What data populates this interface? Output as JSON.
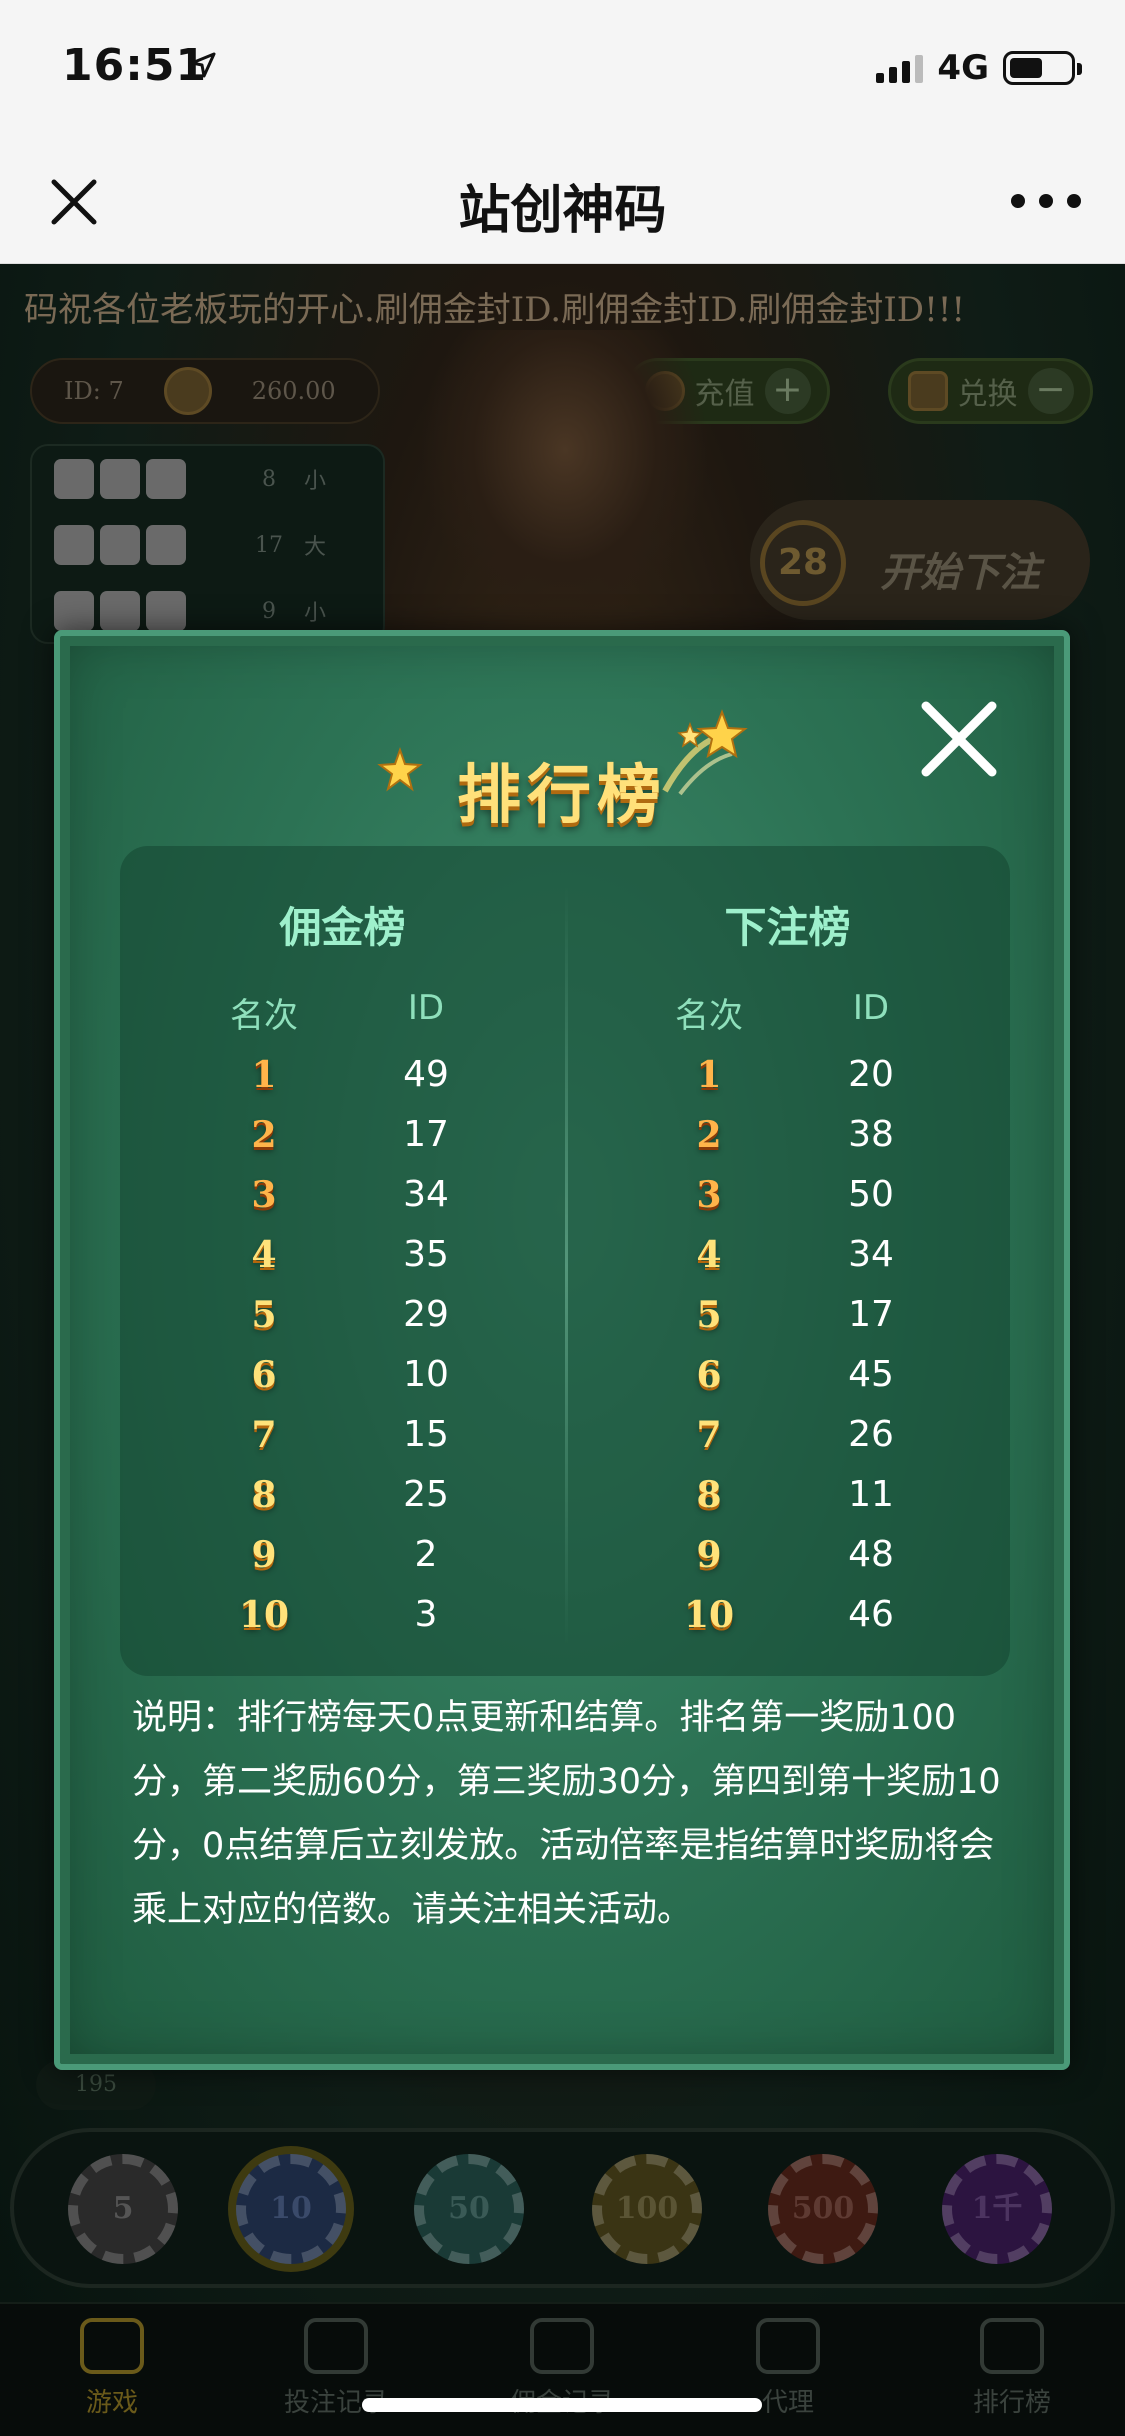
{
  "status_bar": {
    "time": "16:51",
    "network": "4G"
  },
  "nav": {
    "title": "站创神码"
  },
  "game": {
    "marquee": "码祝各位老板玩的开心.刷佣金封ID.刷佣金封ID.刷佣金封ID!!!",
    "user_id": "ID: 7",
    "balance": "260.00",
    "recharge_label": "充值",
    "exchange_label": "兑换",
    "history": [
      {
        "sum": "8",
        "result": "小"
      },
      {
        "sum": "17",
        "result": "大"
      },
      {
        "sum": "9",
        "result": "小"
      }
    ],
    "countdown": "28",
    "start_bet_label": "开始下注",
    "bottom_count": "195",
    "chips": [
      "5",
      "10",
      "50",
      "100",
      "500",
      "1千"
    ],
    "tabs": [
      "游戏",
      "投注记录",
      "佣金记录",
      "代理",
      "排行榜"
    ]
  },
  "leaderboard": {
    "title": "排行榜",
    "commission": {
      "title": "佣金榜",
      "rank_header": "名次",
      "id_header": "ID",
      "rows": [
        {
          "rank": "1",
          "id": "49"
        },
        {
          "rank": "2",
          "id": "17"
        },
        {
          "rank": "3",
          "id": "34"
        },
        {
          "rank": "4",
          "id": "35"
        },
        {
          "rank": "5",
          "id": "29"
        },
        {
          "rank": "6",
          "id": "10"
        },
        {
          "rank": "7",
          "id": "15"
        },
        {
          "rank": "8",
          "id": "25"
        },
        {
          "rank": "9",
          "id": "2"
        },
        {
          "rank": "10",
          "id": "3"
        }
      ]
    },
    "betting": {
      "title": "下注榜",
      "rank_header": "名次",
      "id_header": "ID",
      "rows": [
        {
          "rank": "1",
          "id": "20"
        },
        {
          "rank": "2",
          "id": "38"
        },
        {
          "rank": "3",
          "id": "50"
        },
        {
          "rank": "4",
          "id": "34"
        },
        {
          "rank": "5",
          "id": "17"
        },
        {
          "rank": "6",
          "id": "45"
        },
        {
          "rank": "7",
          "id": "26"
        },
        {
          "rank": "8",
          "id": "11"
        },
        {
          "rank": "9",
          "id": "48"
        },
        {
          "rank": "10",
          "id": "46"
        }
      ]
    },
    "explanation": "说明：排行榜每天0点更新和结算。排名第一奖励100分，第二奖励60分，第三奖励30分，第四到第十奖励10分，0点结算后立刻发放。活动倍率是指结算时奖励将会乘上对应的倍数。请关注相关活动。"
  }
}
